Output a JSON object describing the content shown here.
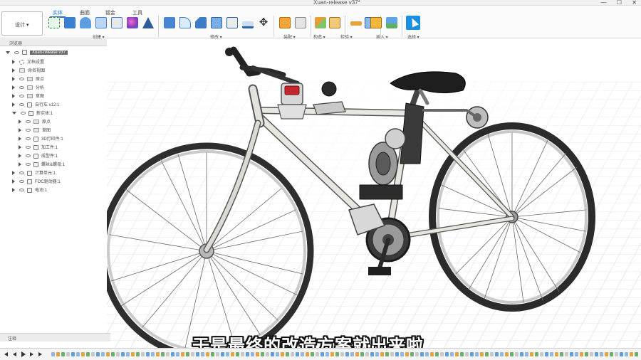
{
  "window": {
    "title": "Xuan-release v37*",
    "controls": [
      "—",
      "☐",
      "✕"
    ]
  },
  "ribbon": {
    "design_button": "设计 ▾",
    "tabs": [
      {
        "label": "实体",
        "active": true
      },
      {
        "label": "曲面",
        "active": false
      },
      {
        "label": "钣金",
        "active": false
      },
      {
        "label": "工具",
        "active": false
      }
    ],
    "groups": [
      "创建 ▾",
      "修改 ▾",
      "装配 ▾",
      "构造 ▾",
      "检验 ▾",
      "插入 ▾",
      "选择 ▾"
    ],
    "colors": {
      "accent": "#1a72d8",
      "select": "#1a8fe0"
    }
  },
  "browser": {
    "header": "浏览器",
    "items": [
      {
        "label": "Xuan-release v37",
        "root": true
      },
      {
        "label": "文档设置"
      },
      {
        "label": "命名视图"
      },
      {
        "label": "原点"
      },
      {
        "label": "分析"
      },
      {
        "label": "草图"
      },
      {
        "label": "自行车 v12:1"
      },
      {
        "label": "新实体:1"
      },
      {
        "label": "原点"
      },
      {
        "label": "草图"
      },
      {
        "label": "3D打印件:1"
      },
      {
        "label": "加工件:1"
      },
      {
        "label": "成型件:1"
      },
      {
        "label": "螺丝&螺母:1"
      },
      {
        "label": "计算单元:1"
      },
      {
        "label": "FOC驱动器:1"
      },
      {
        "label": "电池:1"
      }
    ]
  },
  "comments": {
    "label": "注释"
  },
  "subtitle": "于是最终的改造方案就出来啦"
}
